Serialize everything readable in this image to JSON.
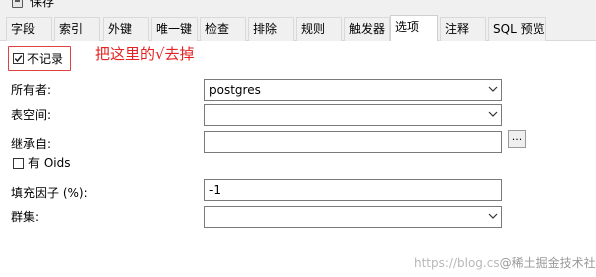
{
  "toolbar": {
    "save_label": "保存",
    "save_icon": "save-icon"
  },
  "tabs": [
    {
      "label": "字段"
    },
    {
      "label": "索引"
    },
    {
      "label": "外键"
    },
    {
      "label": "唯一键"
    },
    {
      "label": "检查"
    },
    {
      "label": "排除"
    },
    {
      "label": "规则"
    },
    {
      "label": "触发器"
    },
    {
      "label": "选项"
    },
    {
      "label": "注释"
    },
    {
      "label": "SQL 预览"
    }
  ],
  "active_tab": "选项",
  "options": {
    "unlogged": {
      "label": "不记录",
      "checked": true
    },
    "annotation": "把这里的√去掉",
    "annotation_color": "#e52222",
    "owner": {
      "label": "所有者:",
      "value": "postgres"
    },
    "tablespace": {
      "label": "表空间:",
      "value": ""
    },
    "inherits": {
      "label": "继承自:",
      "value": "",
      "button_label": "..."
    },
    "with_oids": {
      "label": "有 Oids",
      "checked": false
    },
    "fillfactor": {
      "label": "填充因子 (%):",
      "value": "-1"
    },
    "cluster": {
      "label": "群集:",
      "value": ""
    }
  },
  "watermark": {
    "faint": "https://blog.cs",
    "strong": "@稀土掘金技术社区"
  }
}
